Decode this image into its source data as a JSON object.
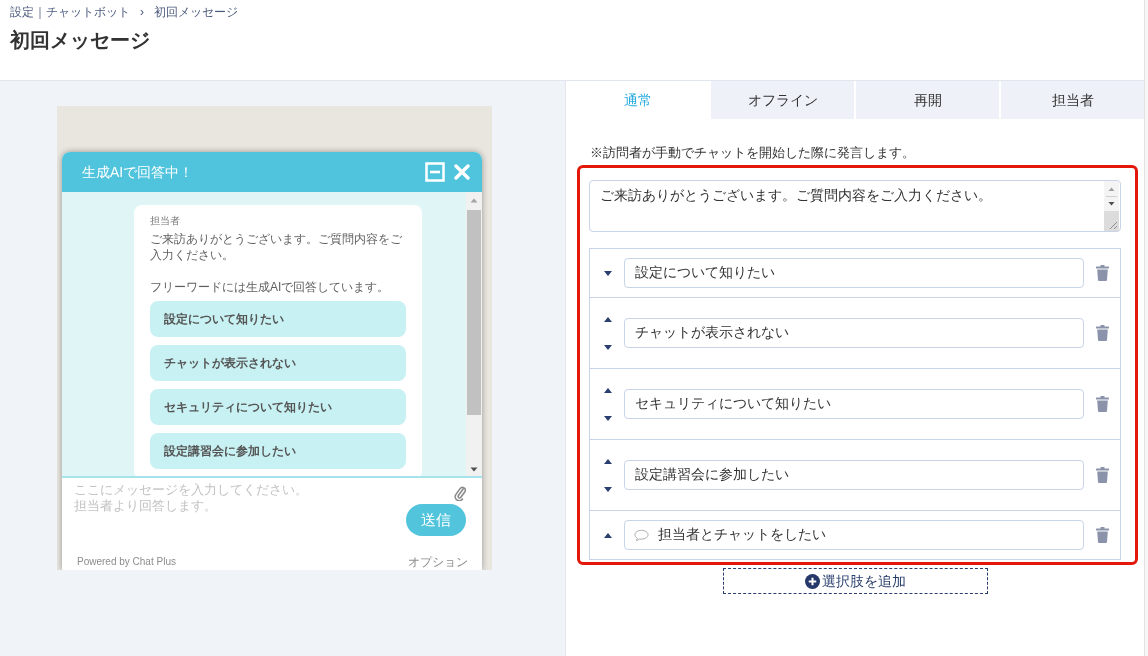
{
  "breadcrumb": {
    "items": [
      "設定｜チャットボット",
      "初回メッセージ"
    ],
    "separator": "›"
  },
  "page_title": "初回メッセージ",
  "preview": {
    "chat_widget": {
      "title": "生成AIで回答中！",
      "message": {
        "sender": "担当者",
        "paragraphs": [
          "ご来訪ありがとうございます。ご質問内容をご入力ください。",
          "フリーワードには生成AIで回答しています。"
        ],
        "choices": [
          "設定について知りたい",
          "チャットが表示されない",
          "セキュリティについて知りたい",
          "設定講習会に参加したい"
        ]
      },
      "input": {
        "placeholder": "ここにメッセージを入力してください。担当者より回答します。"
      },
      "send_button": "送信",
      "footer": {
        "credit": "Powered by Chat Plus",
        "options_link": "オプション"
      }
    }
  },
  "tabs": [
    {
      "label": "通常",
      "selected": true
    },
    {
      "label": "オフライン",
      "selected": false
    },
    {
      "label": "再開",
      "selected": false
    },
    {
      "label": "担当者",
      "selected": false
    }
  ],
  "editor": {
    "note": "※訪問者が手動でチャットを開始した際に発言します。",
    "highlighted": true,
    "message": {
      "value": "ご来訪ありがとうございます。ご質問内容をご入力ください。"
    },
    "choices": [
      {
        "kind": "choice",
        "value": "設定について知りたい"
      },
      {
        "kind": "choice",
        "value": "チャットが表示されない"
      },
      {
        "kind": "choice",
        "value": "セキュリティについて知りたい"
      },
      {
        "kind": "choice",
        "value": "設定講習会に参加したい"
      },
      {
        "kind": "operator",
        "value": "担当者とチャットをしたい"
      }
    ],
    "add_button": "選択肢を追加"
  }
}
